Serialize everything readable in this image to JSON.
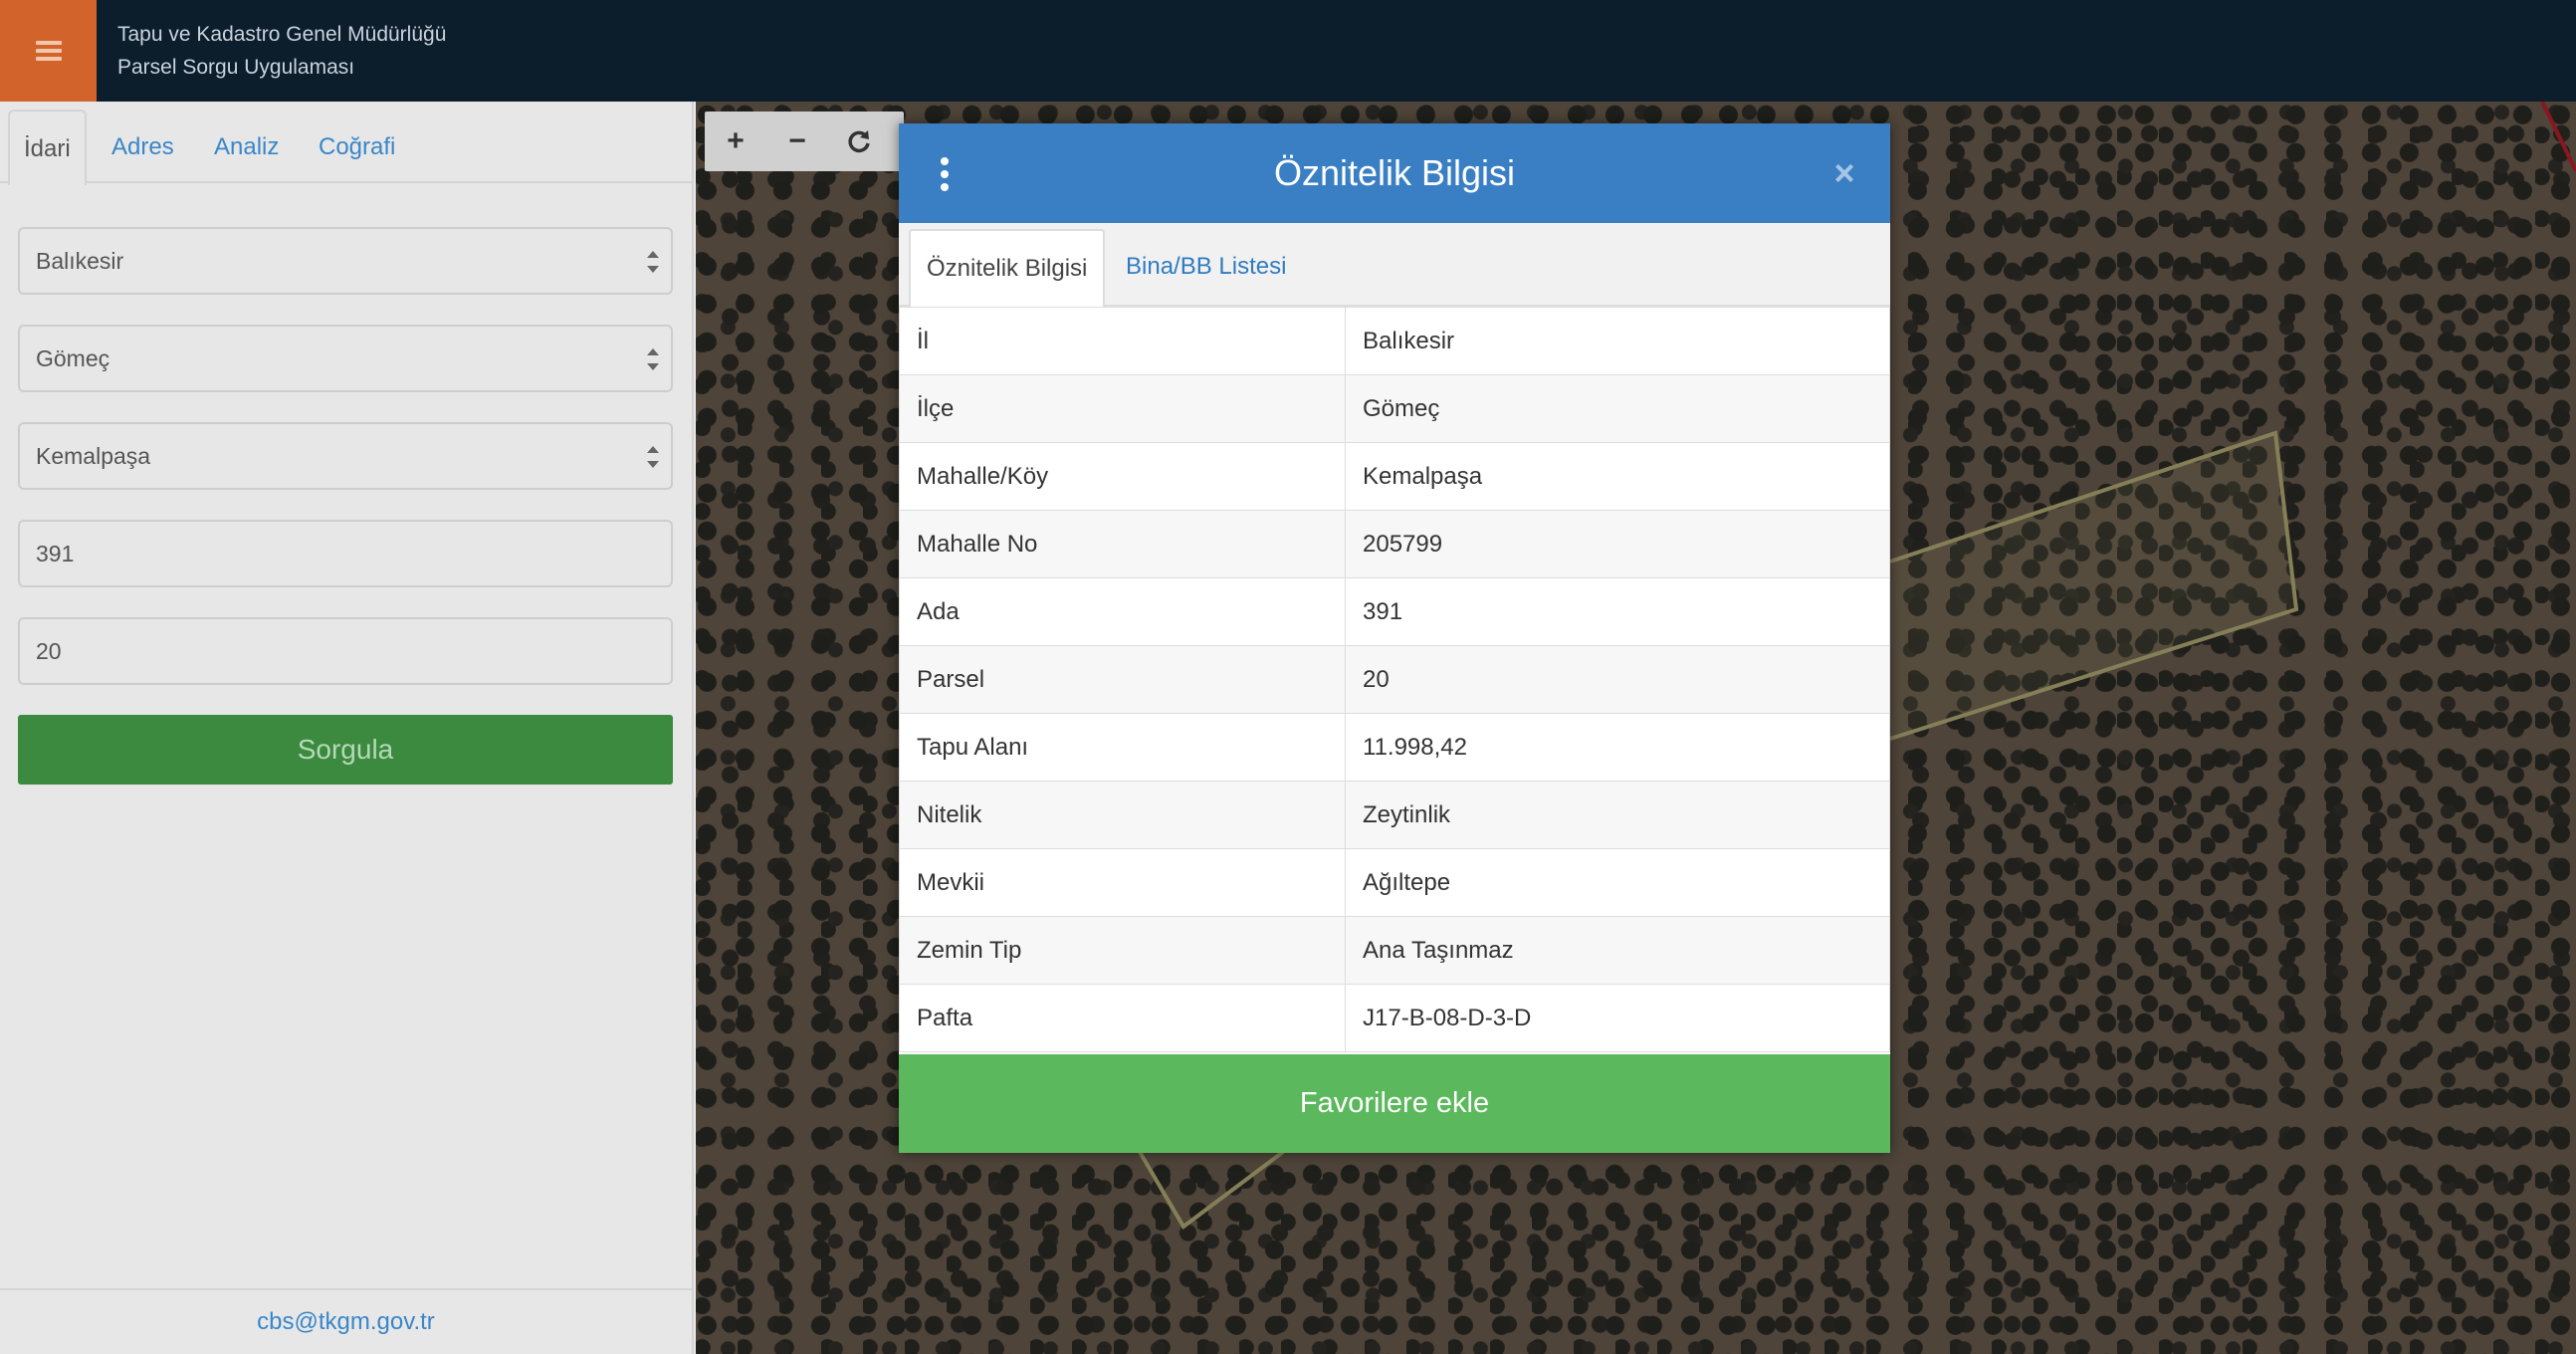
{
  "header": {
    "title_line1": "Tapu ve Kadastro Genel Müdürlüğü",
    "title_line2": "Parsel Sorgu Uygulaması",
    "menu_icon": "hamburger-icon",
    "menu_color": "#d2632a"
  },
  "sidebar": {
    "tabs": [
      {
        "label": "İdari"
      },
      {
        "label": "Adres"
      },
      {
        "label": "Analiz"
      },
      {
        "label": "Coğrafi"
      }
    ],
    "il": "Balıkesir",
    "ilce": "Gömeç",
    "mahalle": "Kemalpaşa",
    "ada": "391",
    "parsel": "20",
    "query_label": "Sorgula",
    "footer_email": "cbs@tkgm.gov.tr"
  },
  "map_controls": {
    "zoom_in": "+",
    "zoom_out": "−",
    "refresh_icon": "refresh-icon"
  },
  "modal": {
    "title": "Öznitelik Bilgisi",
    "close": "×",
    "tabs": [
      {
        "label": "Öznitelik Bilgisi"
      },
      {
        "label": "Bina/BB Listesi"
      }
    ],
    "rows": [
      {
        "key": "İl",
        "value": "Balıkesir"
      },
      {
        "key": "İlçe",
        "value": "Gömeç"
      },
      {
        "key": "Mahalle/Köy",
        "value": "Kemalpaşa"
      },
      {
        "key": "Mahalle No",
        "value": "205799"
      },
      {
        "key": "Ada",
        "value": "391"
      },
      {
        "key": "Parsel",
        "value": "20"
      },
      {
        "key": "Tapu Alanı",
        "value": "11.998,42"
      },
      {
        "key": "Nitelik",
        "value": "Zeytinlik"
      },
      {
        "key": "Mevkii",
        "value": "Ağıltepe"
      },
      {
        "key": "Zemin Tip",
        "value": "Ana Taşınmaz"
      },
      {
        "key": "Pafta",
        "value": "J17-B-08-D-3-D"
      }
    ],
    "favorite_label": "Favorilere ekle",
    "header_color": "#3a7fc4",
    "favorite_color": "#5cb85c"
  }
}
